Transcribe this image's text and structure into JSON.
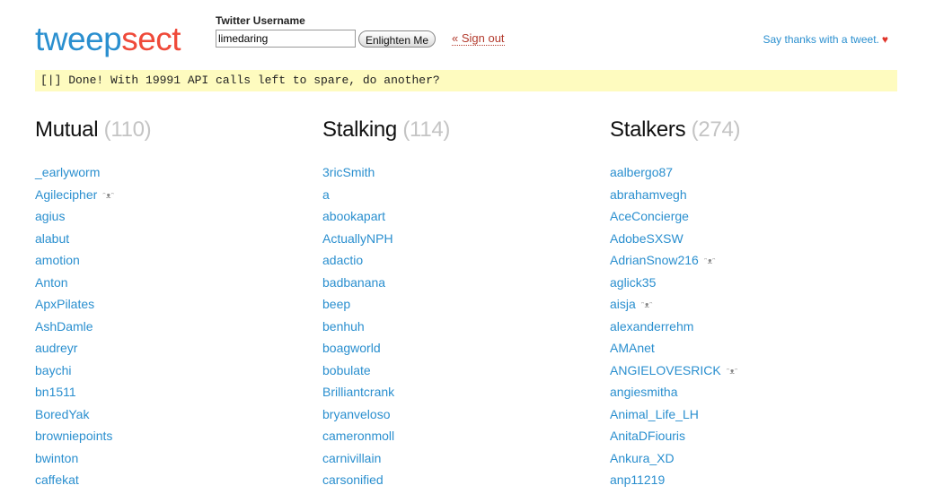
{
  "header": {
    "logo_part1": "tweep",
    "logo_part2": "sect",
    "username_label": "Twitter Username",
    "username_value": "limedaring",
    "submit_label": "Enlighten Me",
    "signout_label": "« Sign out",
    "thanks_label": "Say thanks with a tweet.",
    "heart_glyph": "♥"
  },
  "status": {
    "message": "[|] Done! With 19991 API calls left to spare, do another?"
  },
  "mark_glyph": "ᵔᴥᵔ",
  "columns": [
    {
      "title": "Mutual",
      "count": "(110)",
      "items": [
        {
          "name": "_earlyworm"
        },
        {
          "name": "Agilecipher",
          "marked": true
        },
        {
          "name": "agius"
        },
        {
          "name": "alabut"
        },
        {
          "name": "amotion"
        },
        {
          "name": "Anton"
        },
        {
          "name": "ApxPilates"
        },
        {
          "name": "AshDamle"
        },
        {
          "name": "audreyr"
        },
        {
          "name": "baychi"
        },
        {
          "name": "bn1511"
        },
        {
          "name": "BoredYak"
        },
        {
          "name": "browniepoints"
        },
        {
          "name": "bwinton"
        },
        {
          "name": "caffekat"
        }
      ]
    },
    {
      "title": "Stalking",
      "count": "(114)",
      "items": [
        {
          "name": "3ricSmith"
        },
        {
          "name": "a"
        },
        {
          "name": "abookapart"
        },
        {
          "name": "ActuallyNPH"
        },
        {
          "name": "adactio"
        },
        {
          "name": "badbanana"
        },
        {
          "name": "beep"
        },
        {
          "name": "benhuh"
        },
        {
          "name": "boagworld"
        },
        {
          "name": "bobulate"
        },
        {
          "name": "Brilliantcrank"
        },
        {
          "name": "bryanveloso"
        },
        {
          "name": "cameronmoll"
        },
        {
          "name": "carnivillain"
        },
        {
          "name": "carsonified"
        }
      ]
    },
    {
      "title": "Stalkers",
      "count": "(274)",
      "items": [
        {
          "name": "aalbergo87"
        },
        {
          "name": "abrahamvegh"
        },
        {
          "name": "AceConcierge"
        },
        {
          "name": "AdobeSXSW"
        },
        {
          "name": "AdrianSnow216",
          "marked": true
        },
        {
          "name": "aglick35"
        },
        {
          "name": "aisja",
          "marked": true
        },
        {
          "name": "alexanderrehm"
        },
        {
          "name": "AMAnet"
        },
        {
          "name": "ANGIELOVESRICK",
          "marked": true
        },
        {
          "name": "angiesmitha"
        },
        {
          "name": "Animal_Life_LH"
        },
        {
          "name": "AnitaDFiouris"
        },
        {
          "name": "Ankura_XD"
        },
        {
          "name": "anp11219"
        }
      ]
    }
  ]
}
